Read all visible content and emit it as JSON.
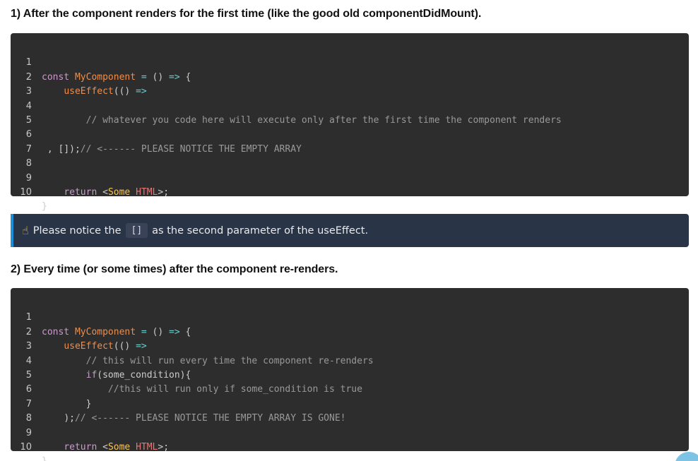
{
  "heading1": "1) After the component renders for the first time (like the good old componentDidMount).",
  "heading2": "2) Every time (or some times) after the component re-renders.",
  "code1": {
    "numbers": [
      "1",
      "2",
      "3",
      "4",
      "5",
      "6",
      "7",
      "8",
      "9",
      "10"
    ],
    "l1": {
      "kw": "const",
      "fn": "MyComponent",
      "op1": "=",
      "paren": "()",
      "op2": "=>",
      "brace": "{"
    },
    "l2": {
      "fn": "useEffect",
      "paren": "(()",
      "op": "=>"
    },
    "l4": {
      "comment": "// whatever you code here will execute only after the first time the component renders"
    },
    "l6": {
      "text": ", []);",
      "comment": "// <------ PLEASE NOTICE THE EMPTY ARRAY"
    },
    "l9": {
      "kw": "return",
      "lt": "<",
      "name": "Some",
      "tag": "HTML",
      "gt": ">;"
    },
    "l10": {
      "brace": "}"
    }
  },
  "notice": {
    "icon": "pointing-up-hand-icon",
    "before": "Please notice the",
    "code": "[]",
    "after": "as the second parameter of the useEffect."
  },
  "code2": {
    "numbers": [
      "1",
      "2",
      "3",
      "4",
      "5",
      "6",
      "7",
      "8",
      "9",
      "10"
    ],
    "l1": {
      "kw": "const",
      "fn": "MyComponent",
      "op1": "=",
      "paren": "()",
      "op2": "=>",
      "brace": "{"
    },
    "l2": {
      "fn": "useEffect",
      "paren": "(()",
      "op": "=>"
    },
    "l3": {
      "comment": "// this will run every time the component re-renders"
    },
    "l4": {
      "kw": "if",
      "rest": "(some_condition){"
    },
    "l5": {
      "comment": "//this will run only if some_condition is true"
    },
    "l6": {
      "brace": "}"
    },
    "l7": {
      "text": ");",
      "comment": "// <------ PLEASE NOTICE THE EMPTY ARRAY IS GONE!"
    },
    "l9": {
      "kw": "return",
      "lt": "<",
      "name": "Some",
      "tag": "HTML",
      "gt": ">;"
    },
    "l10": {
      "brace": "}"
    }
  },
  "colors": {
    "code_bg": "#2d2d2d",
    "notice_bg": "#2a3447",
    "notice_accent": "#1e8fd6"
  }
}
